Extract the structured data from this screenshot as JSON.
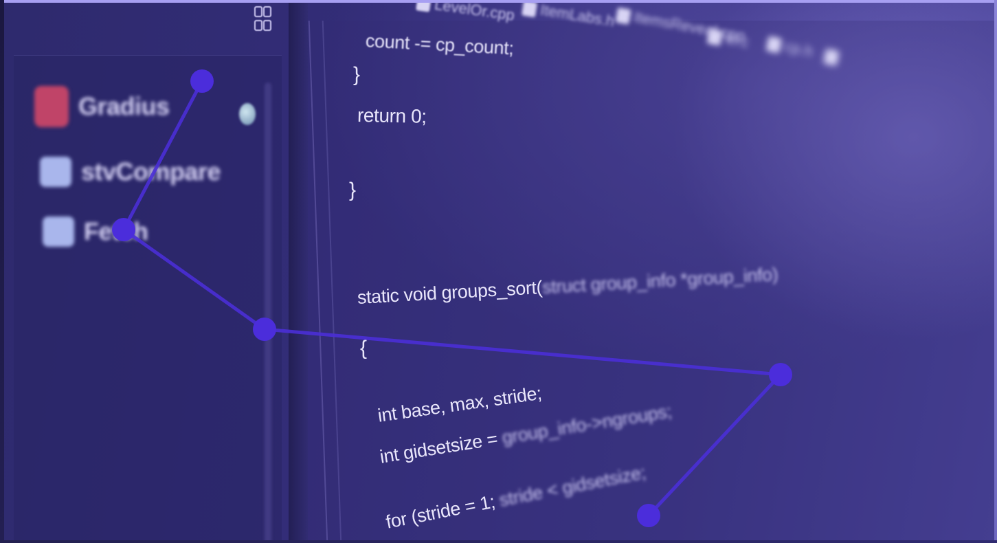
{
  "colors": {
    "background": "#332d78",
    "overlay_line": "#4a2fd6",
    "overlay_node": "#4b2ddb",
    "code_text": "#e9e6fb",
    "file_red": "#c04468",
    "file_blue": "#a9b6ec",
    "top_edge": "#a79ff2"
  },
  "toolbar": {
    "grid_icon": "grid-icon"
  },
  "sidebar": {
    "items": [
      {
        "label": "Gradius",
        "icon": "red-file-icon"
      },
      {
        "label": "stvCompare",
        "icon": "blue-folder-icon"
      },
      {
        "label": "Fetch",
        "icon": "blue-folder-icon"
      }
    ]
  },
  "tabs": [
    {
      "label": "LevelOr.cpp",
      "icon": "file-icon"
    },
    {
      "label": "ItemLabs.h",
      "icon": "file-icon"
    },
    {
      "label": "ItemsReveal.cpp",
      "icon": "file-icon"
    },
    {
      "label": "ltr.c",
      "icon": "file-icon"
    },
    {
      "label": "cp.h",
      "icon": "file-icon"
    },
    {
      "label": "",
      "icon": "file-icon"
    }
  ],
  "editor": {
    "lines": {
      "l1": "count -= cp_count;",
      "l2": "}",
      "l3": "return 0;",
      "l4": "}",
      "l5a": "static void groups_sort(",
      "l5b": "struct group_info *group_info)",
      "l6": "{",
      "l7a": "int base, max, stride;",
      "l8a": "int gidsetsize = ",
      "l8b": "group_info->ngroups;",
      "l9a": "for (stride = 1; ",
      "l9b": "stride < gidsetsize;"
    }
  },
  "overlay": {
    "type": "polyline",
    "node_count": 6
  }
}
